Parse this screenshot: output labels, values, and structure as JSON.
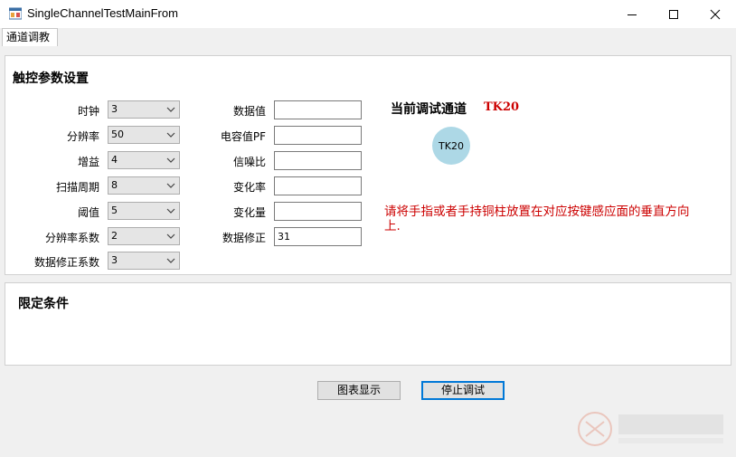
{
  "window": {
    "title": "SingleChannelTestMainFrom"
  },
  "tabs": [
    {
      "label": "通道调教"
    }
  ],
  "touch_group": {
    "title": "触控参数设置",
    "combos": [
      {
        "label": "时钟",
        "value": "3"
      },
      {
        "label": "分辨率",
        "value": "50"
      },
      {
        "label": "增益",
        "value": "4"
      },
      {
        "label": "扫描周期",
        "value": "8"
      },
      {
        "label": "阈值",
        "value": "5"
      },
      {
        "label": "分辨率系数",
        "value": "2"
      },
      {
        "label": "数据修正系数",
        "value": "3"
      }
    ],
    "fields": [
      {
        "label": "数据值",
        "value": ""
      },
      {
        "label": "电容值PF",
        "value": ""
      },
      {
        "label": "信噪比",
        "value": ""
      },
      {
        "label": "变化率",
        "value": ""
      },
      {
        "label": "变化量",
        "value": ""
      },
      {
        "label": "数据修正",
        "value": "31"
      }
    ],
    "current_channel_label": "当前调试通道",
    "current_channel_value": "TK20",
    "channel_button": "TK20",
    "instruction": "请将手指或者手持铜柱放置在对应按键感应面的垂直方向上."
  },
  "limit_group": {
    "title": "限定条件"
  },
  "buttons": {
    "chart": "图表显示",
    "stop": "停止调试"
  },
  "colors": {
    "channel_red": "#cc0000",
    "circle": "#add8e6",
    "focus_blue": "#0078d7"
  }
}
